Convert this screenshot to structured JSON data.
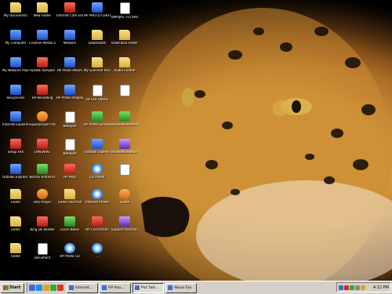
{
  "desktop": {
    "icons": [
      {
        "label": "My Documents",
        "glyph": "folder"
      },
      {
        "label": "New Folder",
        "glyph": "folder"
      },
      {
        "label": "Internet Cafe Edition",
        "glyph": "red"
      },
      {
        "label": "HP PHOTO CENTER",
        "glyph": "app"
      },
      {
        "label": "BMP/JPG TUTORIALS",
        "glyph": "doc"
      },
      {
        "label": "My Computer",
        "glyph": "app"
      },
      {
        "label": "Creative Media Source",
        "glyph": "app"
      },
      {
        "label": "Network",
        "glyph": "app"
      },
      {
        "label": "Downloads",
        "glyph": "folder"
      },
      {
        "label": "Download Folder",
        "glyph": "folder"
      },
      {
        "label": "My Network Places",
        "glyph": "app"
      },
      {
        "label": "ADOBE READER",
        "glyph": "red"
      },
      {
        "label": "HP Photo Album",
        "glyph": "app"
      },
      {
        "label": "My Scanned Pictures",
        "glyph": "folder"
      },
      {
        "label": "Audio Control",
        "glyph": "folder"
      },
      {
        "label": "Recycle Bin",
        "glyph": "app"
      },
      {
        "label": "HP Recording",
        "glyph": "red"
      },
      {
        "label": "HP Photo Imaging",
        "glyph": "app"
      },
      {
        "label": "HP SOFTWARE",
        "glyph": "doc"
      },
      {
        "label": "...",
        "glyph": "doc"
      },
      {
        "label": "Internet Explorer",
        "glyph": "app"
      },
      {
        "label": "SuperJumper Player",
        "glyph": "orange"
      },
      {
        "label": "Notepad",
        "glyph": "doc"
      },
      {
        "label": "HP Photo Scheduler",
        "glyph": "green"
      },
      {
        "label": "Windows Messenger",
        "glyph": "green"
      },
      {
        "label": "Setup FAX",
        "glyph": "red"
      },
      {
        "label": "LIMEWIRE",
        "glyph": "red"
      },
      {
        "label": "Notepad",
        "glyph": "doc"
      },
      {
        "label": "Outlook Express",
        "glyph": "app"
      },
      {
        "label": "Windows Media Player",
        "glyph": "purple"
      },
      {
        "label": "Outlook Express Signature",
        "glyph": "app"
      },
      {
        "label": "Norton AntiVirus",
        "glyph": "green"
      },
      {
        "label": "HP Help",
        "glyph": "red"
      },
      {
        "label": "CD Player",
        "glyph": "cd"
      },
      {
        "label": "...",
        "glyph": "doc"
      },
      {
        "label": "Folder",
        "glyph": "folder"
      },
      {
        "label": "DVD Player",
        "glyph": "orange"
      },
      {
        "label": "Game Shortcut",
        "glyph": "folder"
      },
      {
        "label": "Internet Phone",
        "glyph": "cd"
      },
      {
        "label": "Game",
        "glyph": "orange"
      },
      {
        "label": "Folder",
        "glyph": "folder"
      },
      {
        "label": "Bing DE Reader",
        "glyph": "red"
      },
      {
        "label": "Focus Nokia",
        "glyph": "green"
      },
      {
        "label": "HP Connection",
        "glyph": "red"
      },
      {
        "label": "Support Assistant",
        "glyph": "purple"
      },
      {
        "label": "Folder",
        "glyph": "folder"
      },
      {
        "label": "Document",
        "glyph": "doc"
      },
      {
        "label": "HP Photo CD",
        "glyph": "cd"
      },
      {
        "label": "...",
        "glyph": "cd"
      }
    ]
  },
  "taskbar": {
    "start_label": "Start",
    "tasks": [
      {
        "label": "Internet...",
        "active": false
      },
      {
        "label": "HP Ima...",
        "active": false
      },
      {
        "label": "Pict Talk...",
        "active": true
      },
      {
        "label": "About Fax",
        "active": false
      }
    ],
    "clock": "4:12 PM"
  }
}
